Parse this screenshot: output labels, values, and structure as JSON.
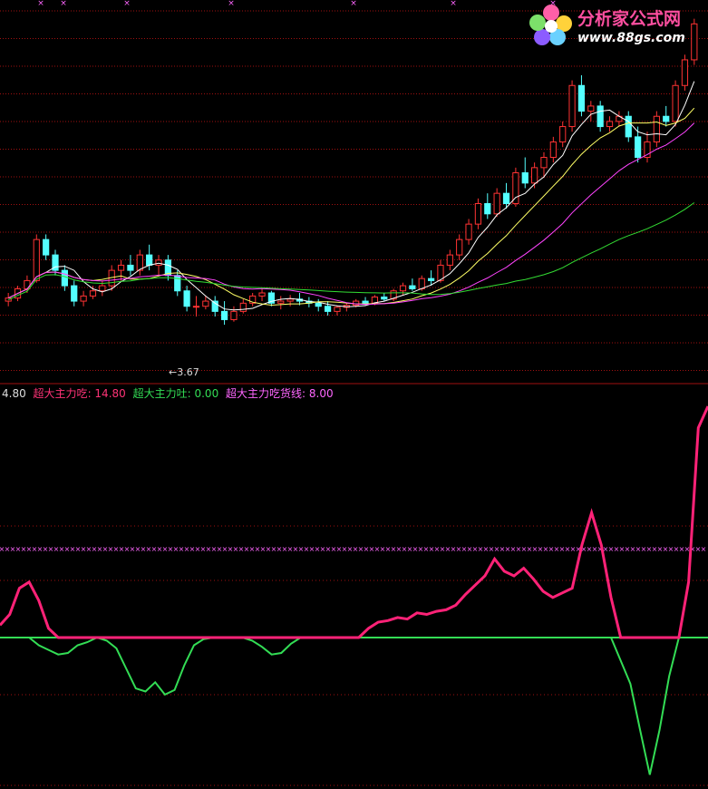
{
  "chart_data": [
    {
      "type": "candlestick",
      "title": "",
      "min_label": "3.67",
      "colors": {
        "up": "#ff3333",
        "down": "#54ffff",
        "ma5": "#ffffff",
        "ma10": "#ffff66",
        "ma20": "#ff44ff",
        "ma60": "#33dd33",
        "grid": "#a01010"
      },
      "ylim": [
        3.3,
        6.7
      ],
      "grid": true,
      "candles": [
        [
          3.9,
          3.98,
          3.85,
          3.93
        ],
        [
          3.93,
          4.05,
          3.9,
          4.02
        ],
        [
          4.02,
          4.15,
          3.98,
          4.1
        ],
        [
          4.1,
          4.55,
          4.08,
          4.5
        ],
        [
          4.5,
          4.55,
          4.3,
          4.35
        ],
        [
          4.35,
          4.4,
          4.15,
          4.2
        ],
        [
          4.2,
          4.25,
          4.0,
          4.05
        ],
        [
          4.05,
          4.1,
          3.85,
          3.9
        ],
        [
          3.9,
          4.0,
          3.85,
          3.95
        ],
        [
          3.95,
          4.05,
          3.92,
          4.0
        ],
        [
          4.0,
          4.1,
          3.95,
          4.05
        ],
        [
          4.05,
          4.25,
          4.0,
          4.2
        ],
        [
          4.2,
          4.3,
          4.1,
          4.25
        ],
        [
          4.25,
          4.35,
          4.15,
          4.2
        ],
        [
          4.2,
          4.4,
          4.15,
          4.35
        ],
        [
          4.35,
          4.45,
          4.2,
          4.25
        ],
        [
          4.25,
          4.35,
          4.15,
          4.3
        ],
        [
          4.3,
          4.35,
          4.1,
          4.15
        ],
        [
          4.15,
          4.2,
          3.95,
          4.0
        ],
        [
          4.0,
          4.05,
          3.8,
          3.85
        ],
        [
          3.85,
          3.95,
          3.75,
          3.85
        ],
        [
          3.85,
          3.95,
          3.82,
          3.9
        ],
        [
          3.9,
          3.95,
          3.75,
          3.8
        ],
        [
          3.8,
          3.9,
          3.67,
          3.72
        ],
        [
          3.72,
          3.85,
          3.7,
          3.8
        ],
        [
          3.8,
          3.92,
          3.78,
          3.88
        ],
        [
          3.88,
          3.98,
          3.85,
          3.95
        ],
        [
          3.95,
          4.02,
          3.9,
          3.98
        ],
        [
          3.98,
          4.0,
          3.85,
          3.88
        ],
        [
          3.88,
          3.95,
          3.82,
          3.9
        ],
        [
          3.9,
          3.96,
          3.85,
          3.92
        ],
        [
          3.92,
          3.98,
          3.86,
          3.9
        ],
        [
          3.9,
          3.94,
          3.84,
          3.88
        ],
        [
          3.88,
          3.92,
          3.8,
          3.85
        ],
        [
          3.85,
          3.9,
          3.76,
          3.8
        ],
        [
          3.8,
          3.86,
          3.76,
          3.84
        ],
        [
          3.84,
          3.88,
          3.8,
          3.86
        ],
        [
          3.86,
          3.92,
          3.84,
          3.9
        ],
        [
          3.9,
          3.94,
          3.86,
          3.88
        ],
        [
          3.88,
          3.96,
          3.86,
          3.94
        ],
        [
          3.94,
          3.98,
          3.9,
          3.92
        ],
        [
          3.92,
          4.02,
          3.9,
          4.0
        ],
        [
          4.0,
          4.08,
          3.96,
          4.05
        ],
        [
          4.05,
          4.12,
          4.0,
          4.02
        ],
        [
          4.02,
          4.15,
          4.0,
          4.12
        ],
        [
          4.12,
          4.2,
          4.05,
          4.1
        ],
        [
          4.1,
          4.3,
          4.08,
          4.25
        ],
        [
          4.25,
          4.4,
          4.2,
          4.35
        ],
        [
          4.35,
          4.55,
          4.3,
          4.5
        ],
        [
          4.5,
          4.7,
          4.45,
          4.65
        ],
        [
          4.65,
          4.9,
          4.6,
          4.85
        ],
        [
          4.85,
          4.95,
          4.7,
          4.75
        ],
        [
          4.75,
          5.0,
          4.72,
          4.95
        ],
        [
          4.95,
          5.05,
          4.8,
          4.85
        ],
        [
          4.85,
          5.2,
          4.82,
          5.15
        ],
        [
          5.15,
          5.3,
          5.0,
          5.05
        ],
        [
          5.05,
          5.25,
          5.0,
          5.2
        ],
        [
          5.2,
          5.35,
          5.1,
          5.3
        ],
        [
          5.3,
          5.5,
          5.25,
          5.45
        ],
        [
          5.45,
          5.65,
          5.4,
          5.6
        ],
        [
          5.6,
          6.05,
          5.55,
          6.0
        ],
        [
          6.0,
          6.1,
          5.7,
          5.75
        ],
        [
          5.75,
          5.85,
          5.65,
          5.8
        ],
        [
          5.8,
          5.85,
          5.55,
          5.6
        ],
        [
          5.6,
          5.7,
          5.55,
          5.65
        ],
        [
          5.65,
          5.75,
          5.6,
          5.7
        ],
        [
          5.7,
          5.75,
          5.45,
          5.5
        ],
        [
          5.5,
          5.6,
          5.25,
          5.3
        ],
        [
          5.3,
          5.55,
          5.25,
          5.45
        ],
        [
          5.45,
          5.75,
          5.4,
          5.7
        ],
        [
          5.7,
          5.8,
          5.6,
          5.65
        ],
        [
          5.65,
          6.05,
          5.6,
          6.0
        ],
        [
          6.0,
          6.3,
          5.95,
          6.25
        ],
        [
          6.25,
          6.65,
          6.2,
          6.6
        ]
      ]
    },
    {
      "type": "line",
      "series": [
        {
          "name": "超大主力吃",
          "color": "#ff2277",
          "label_value": "14.80"
        },
        {
          "name": "超大主力吐",
          "color": "#33dd55",
          "label_value": "0.00"
        },
        {
          "name": "超大主力吃货线",
          "color": "#ff66ff",
          "label_value": "8.00"
        }
      ],
      "axis_value": "4.80"
    }
  ],
  "logo": {
    "title": "分析家公式网",
    "url": "www.88gs.com"
  }
}
